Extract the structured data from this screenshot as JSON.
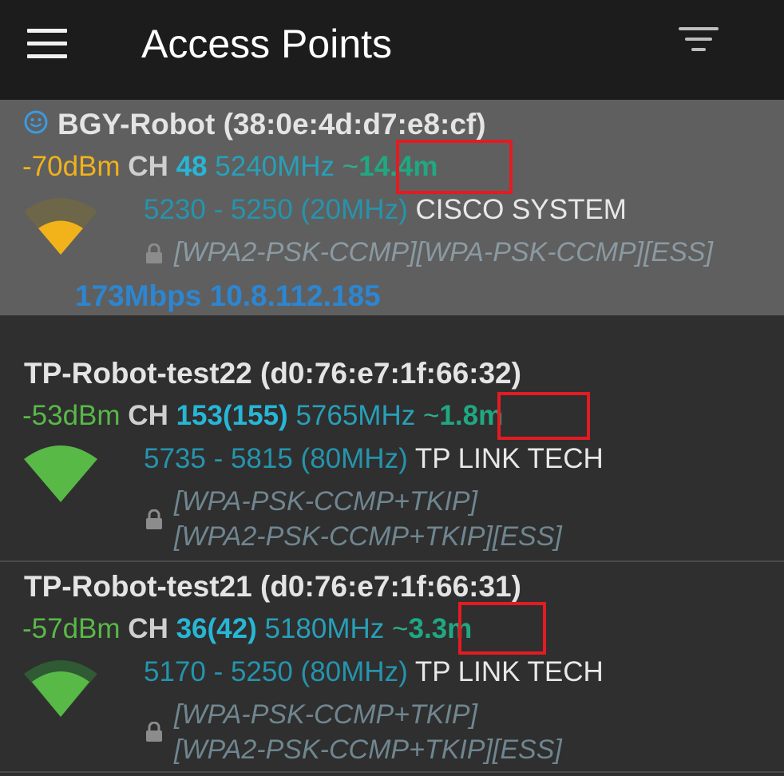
{
  "app_bar": {
    "title": "Access Points",
    "menu_icon": "hamburger-menu-icon",
    "filter_icon": "filter-icon"
  },
  "colors": {
    "signal_weak": "#f2b21a",
    "signal_good": "#58b947",
    "channel": "#27b6d6",
    "distance": "#20a883",
    "highlight_box": "#e31b23",
    "connected_row_bg": "#5f5f5f",
    "link_info": "#2c86d2"
  },
  "access_points": [
    {
      "ssid_bssid": "BGY-Robot (38:0e:4d:d7:e8:cf)",
      "connected": true,
      "connected_icon": "smiley-icon",
      "signal": "-70dBm",
      "signal_level": 0.35,
      "channel_label": "CH",
      "channel": "48",
      "frequency": "5240MHz",
      "tilde": "~",
      "distance": "14.4m",
      "range": "5230 - 5250 (20MHz)",
      "vendor": "CISCO SYSTEM",
      "security_lines": [
        "[WPA2-PSK-CCMP][WPA-PSK-CCMP][ESS]"
      ],
      "link_info": "173Mbps 10.8.112.185"
    },
    {
      "ssid_bssid": "TP-Robot-test22 (d0:76:e7:1f:66:32)",
      "connected": false,
      "signal": "-53dBm",
      "signal_level": 1.0,
      "channel_label": "CH",
      "channel": "153(155)",
      "frequency": "5765MHz",
      "tilde": "~",
      "distance": "1.8m",
      "range": "5735 - 5815 (80MHz)",
      "vendor": "TP LINK TECH",
      "security_lines": [
        "[WPA-PSK-CCMP+TKIP]",
        "[WPA2-PSK-CCMP+TKIP][ESS]"
      ]
    },
    {
      "ssid_bssid": "TP-Robot-test21 (d0:76:e7:1f:66:31)",
      "connected": false,
      "signal": "-57dBm",
      "signal_level": 0.75,
      "channel_label": "CH",
      "channel": "36(42)",
      "frequency": "5180MHz",
      "tilde": "~",
      "distance": "3.3m",
      "range": "5170 - 5250 (80MHz)",
      "vendor": "TP LINK TECH",
      "security_lines": [
        "[WPA-PSK-CCMP+TKIP]",
        "[WPA2-PSK-CCMP+TKIP][ESS]"
      ]
    }
  ]
}
